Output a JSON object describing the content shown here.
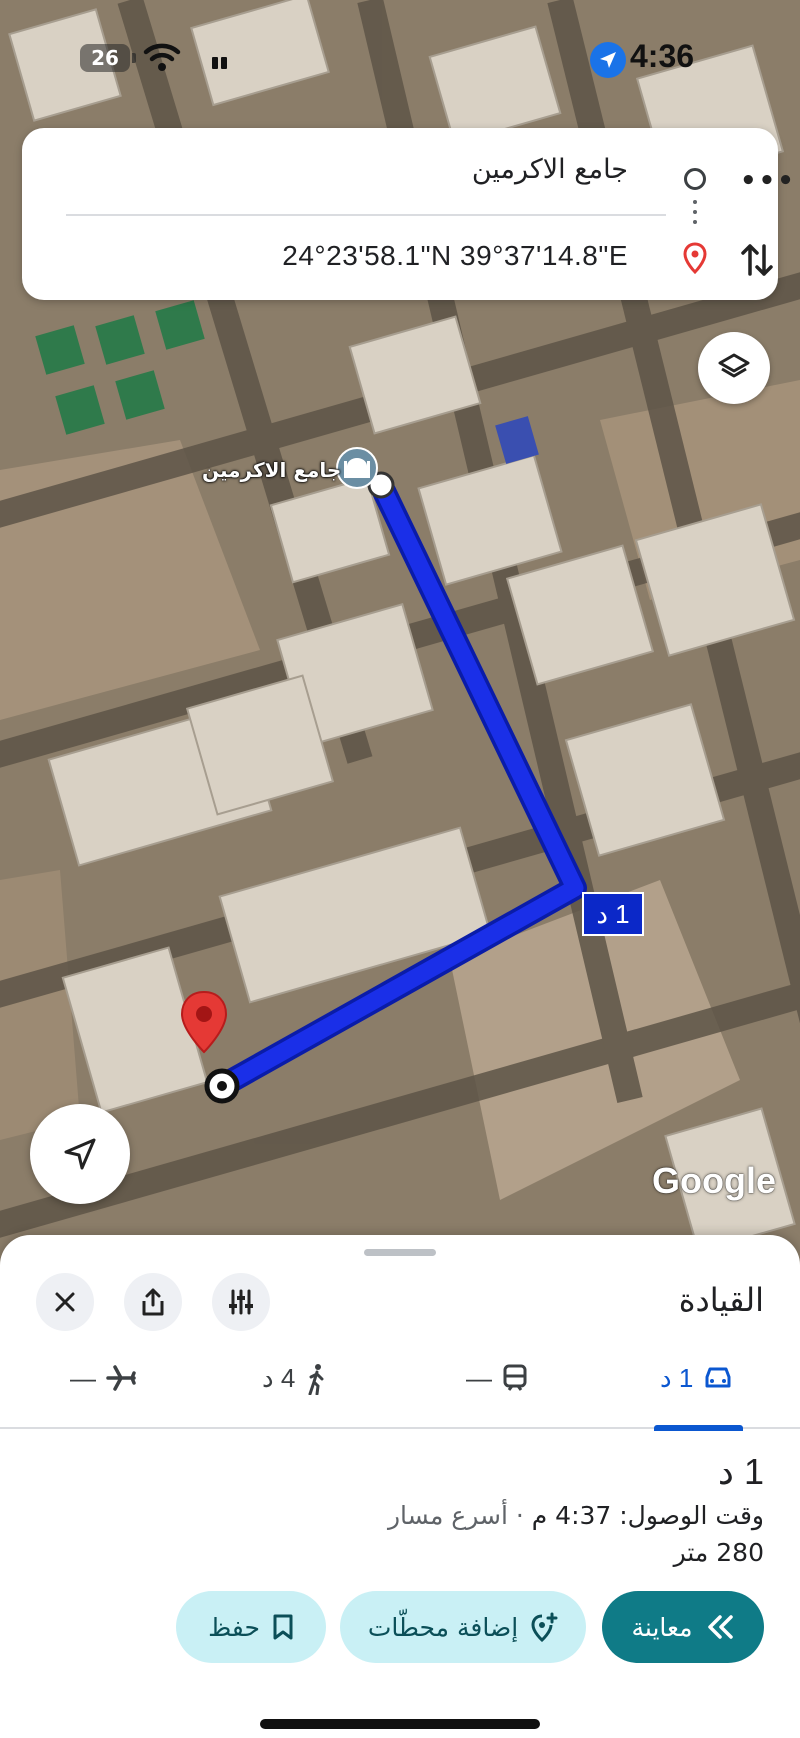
{
  "status_bar": {
    "battery": "26",
    "time": "4:36",
    "icons": [
      "battery-icon",
      "wifi-icon",
      "signal-icon",
      "location-arrow-icon"
    ]
  },
  "route_card": {
    "origin": "جامع الاكرمين",
    "destination": "24°23'58.1\"N 39°37'14.8\"E",
    "icons": [
      "origin-circle-icon",
      "destination-pin-icon",
      "more-icon",
      "swap-icon"
    ]
  },
  "map": {
    "mosque_label": "جامع الاكرمين",
    "route_duration_chip": "1 د",
    "attribution": "Google",
    "route_color": "#1a2fe8"
  },
  "sheet": {
    "title": "القيادة",
    "tabs": [
      {
        "name": "drive",
        "icon": "car-icon",
        "value": "1 د",
        "active": true
      },
      {
        "name": "transit",
        "icon": "train-icon",
        "value": "—",
        "active": false
      },
      {
        "name": "walk",
        "icon": "walk-icon",
        "value": "4 د",
        "active": false
      },
      {
        "name": "flight",
        "icon": "plane-icon",
        "value": "—",
        "active": false
      }
    ],
    "duration": "1 د",
    "arrival_label": "وقت الوصول: 4:37 م",
    "arrival_note": " · أسرع مسار",
    "distance": "280 متر",
    "actions": {
      "preview": "معاينة",
      "add_stops": "إضافة محطّات",
      "save": "حفظ"
    }
  },
  "colors": {
    "accent": "#0b57d0",
    "teal_button": "#0f7b87",
    "light_button": "#c9f0f5",
    "pin_red": "#e53935"
  }
}
